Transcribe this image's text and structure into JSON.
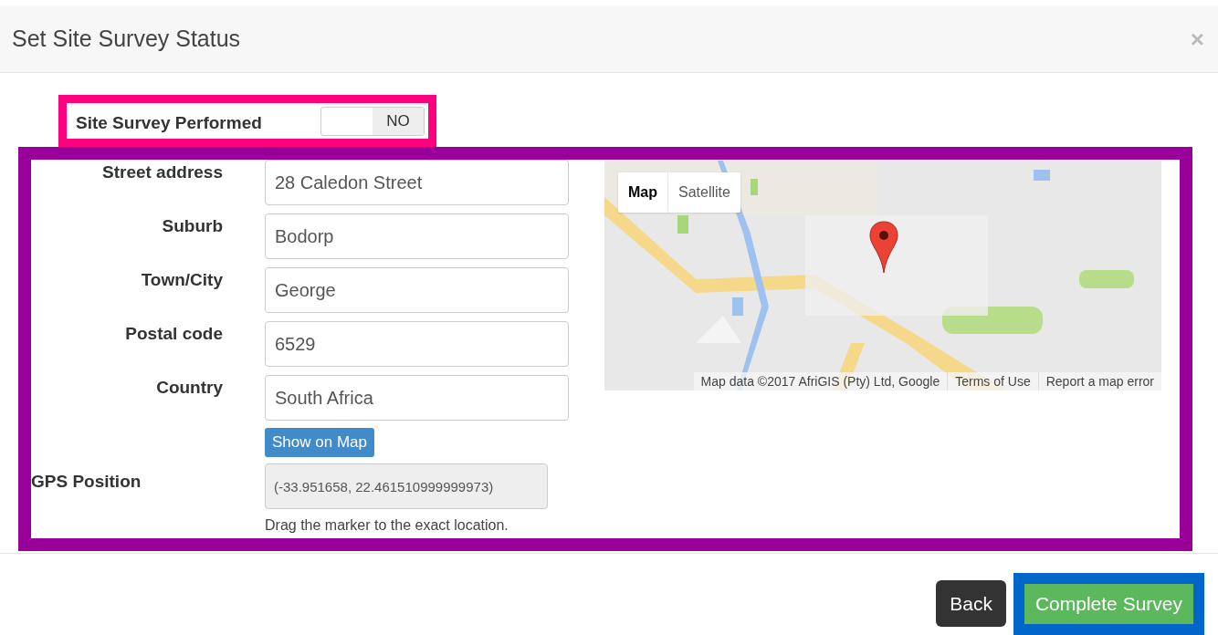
{
  "dialog": {
    "title": "Set Site Survey Status",
    "close": "×"
  },
  "survey_performed": {
    "label": "Site Survey Performed",
    "on": false,
    "off_text": "NO"
  },
  "address_fields": [
    {
      "label": "Street address",
      "value": "28 Caledon Street"
    },
    {
      "label": "Suburb",
      "value": "Bodorp"
    },
    {
      "label": "Town/City",
      "value": "George"
    },
    {
      "label": "Postal code",
      "value": "6529"
    },
    {
      "label": "Country",
      "value": "South Africa"
    }
  ],
  "show_on_map_button": "Show on Map",
  "gps": {
    "label": "GPS Position",
    "value": "(-33.951658, 22.461510999999973)",
    "help": "Drag the marker to the exact location.",
    "disabled": true
  },
  "map": {
    "map_types": [
      {
        "label": "Map",
        "selected": true
      },
      {
        "label": "Satellite",
        "selected": false
      }
    ],
    "attribution": [
      "Map data ©2017 AfriGIS (Pty) Ltd, Google",
      "Terms of Use",
      "Report a map error"
    ]
  },
  "footer_buttons": [
    {
      "label": "Back",
      "kind": "secondary"
    },
    {
      "label": "Complete Survey",
      "kind": "success"
    }
  ]
}
